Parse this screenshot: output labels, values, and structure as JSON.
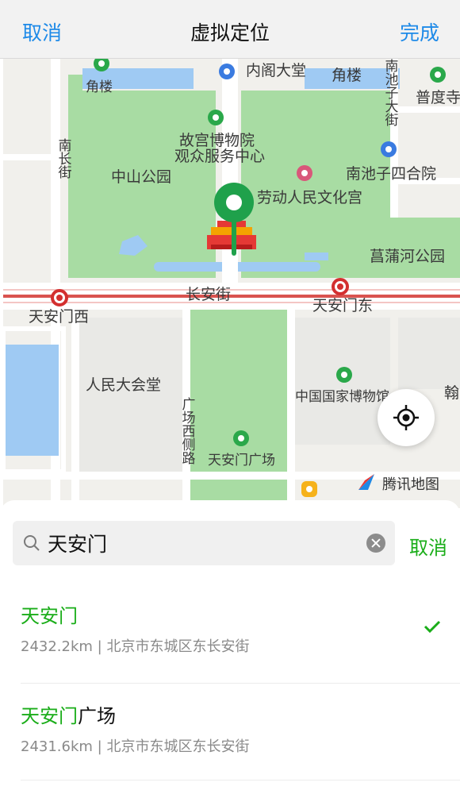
{
  "header": {
    "cancel_label": "取消",
    "title": "虚拟定位",
    "done_label": "完成"
  },
  "map": {
    "labels": {
      "jiaolou_left": "角楼",
      "neigedadang": "内阁大堂",
      "jiaolou_right": "角楼",
      "nanchizidajie": "南池子大街",
      "pudusi": "普度寺",
      "gugong_service_1": "故宫博物院",
      "gugong_service_2": "观众服务中心",
      "nanchangjie": "南长街",
      "zhongshan_park": "中山公园",
      "nanchizi_siheyuan": "南池子四合院",
      "laodong_palace": "劳动人民文化宫",
      "changpuhe_park": "菖蒲河公园",
      "changanjie": "长安街",
      "tiananmen_west": "天安门西",
      "tiananmen_east": "天安门东",
      "great_hall": "人民大会堂",
      "national_museum": "中国国家博物馆",
      "guangchang_xice_road": "广场西侧路",
      "tiananmen_square": "天安门广场",
      "han_partial": "翰"
    },
    "brand": "腾讯地图",
    "locate_icon": "crosshair-icon",
    "pin_icon": "location-pin-icon",
    "colors": {
      "park": "#a8dca3",
      "water": "#9fcaf3",
      "road_main": "#ffffff",
      "avenue_stripe": "#d9534f",
      "pin": "#1fa14b",
      "link_blue": "#1e8ae8",
      "accent_green": "#1aad19"
    }
  },
  "search": {
    "query": "天安门",
    "search_icon": "search-icon",
    "clear_icon": "clear-icon",
    "cancel_label": "取消"
  },
  "results": [
    {
      "name_highlight": "天安门",
      "name_rest": "",
      "detail": "2432.2km | 北京市东城区东长安街",
      "selected": true,
      "check_icon": "checkmark-icon"
    },
    {
      "name_highlight": "天安门",
      "name_rest": "广场",
      "detail": "2431.6km | 北京市东城区东长安街",
      "selected": false
    }
  ]
}
